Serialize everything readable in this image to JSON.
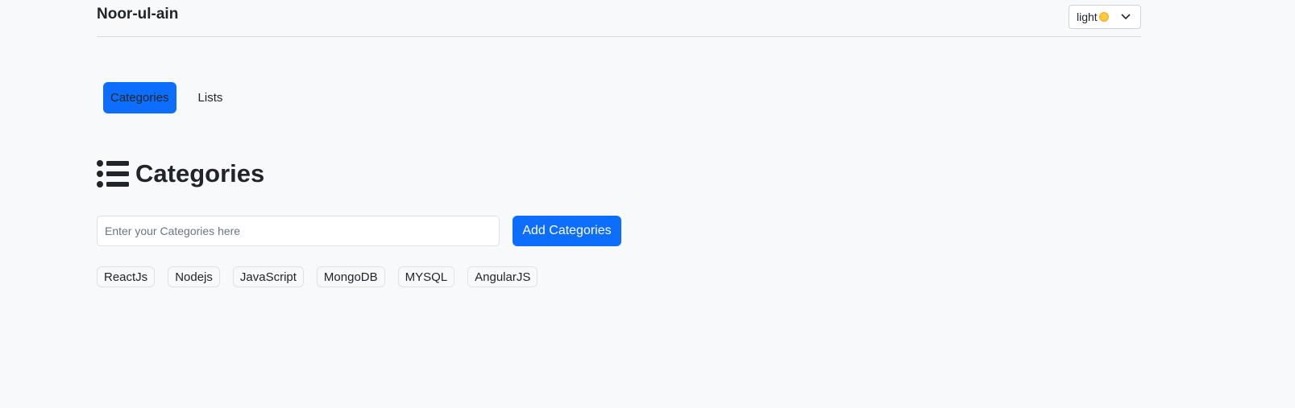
{
  "header": {
    "brand": "Noor-ul-ain",
    "theme_select": {
      "value": "light",
      "icon": "sun-icon"
    }
  },
  "tabs": [
    {
      "label": "Categories",
      "active": true
    },
    {
      "label": "Lists",
      "active": false
    }
  ],
  "section": {
    "icon": "list-icon",
    "title": "Categories"
  },
  "form": {
    "input_placeholder": "Enter your Categories here",
    "input_value": "",
    "add_button_label": "Add Categories"
  },
  "categories": [
    "ReactJs",
    "Nodejs",
    "JavaScript",
    "MongoDB",
    "MYSQL",
    "AngularJS"
  ],
  "colors": {
    "primary": "#0d6efd",
    "background": "#f8f9fa",
    "text": "#212529"
  }
}
